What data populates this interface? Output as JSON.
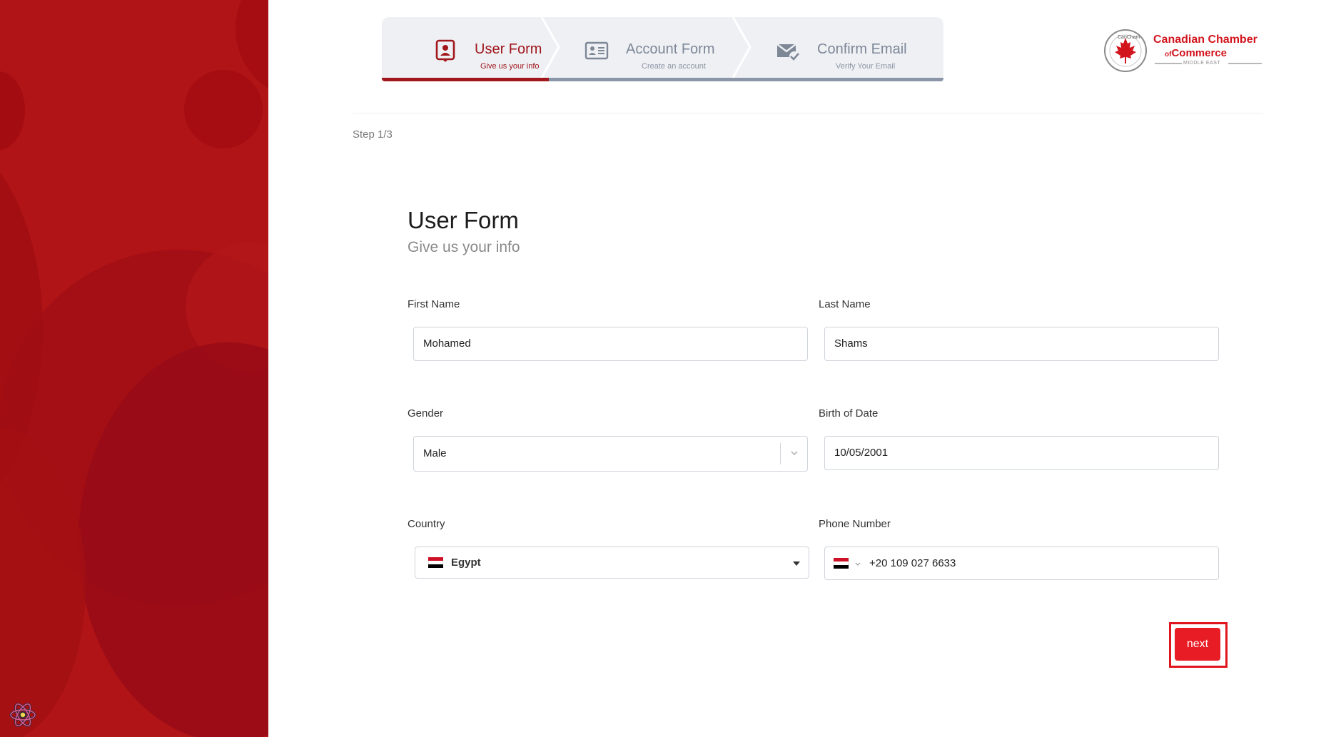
{
  "stepper": {
    "steps": [
      {
        "title": "User Form",
        "subtitle": "Give us your info",
        "icon": "user-badge-icon",
        "active": true
      },
      {
        "title": "Account Form",
        "subtitle": "Create an account",
        "icon": "id-card-icon",
        "active": false
      },
      {
        "title": "Confirm Email",
        "subtitle": "Verify Your Email",
        "icon": "mail-check-icon",
        "active": false
      }
    ]
  },
  "logo": {
    "title": "Canadian Chamber",
    "sub_prefix": "of",
    "sub_main": "Commerce",
    "region": "MIDDLE EAST",
    "seal_text": "CanCham"
  },
  "step_count": "Step 1/3",
  "form": {
    "title": "User Form",
    "subtitle": "Give us your info",
    "first_name_label": "First Name",
    "first_name_value": "Mohamed",
    "last_name_label": "Last Name",
    "last_name_value": "Shams",
    "gender_label": "Gender",
    "gender_value": "Male",
    "birth_label": "Birth of Date",
    "birth_value": "10/05/2001",
    "country_label": "Country",
    "country_value": "Egypt",
    "phone_label": "Phone Number",
    "phone_value": "+20 109 027 6633",
    "next_label": "next"
  },
  "colors": {
    "brand_red": "#b01417",
    "active_step": "#a1161b",
    "button_red": "#e81c25"
  }
}
